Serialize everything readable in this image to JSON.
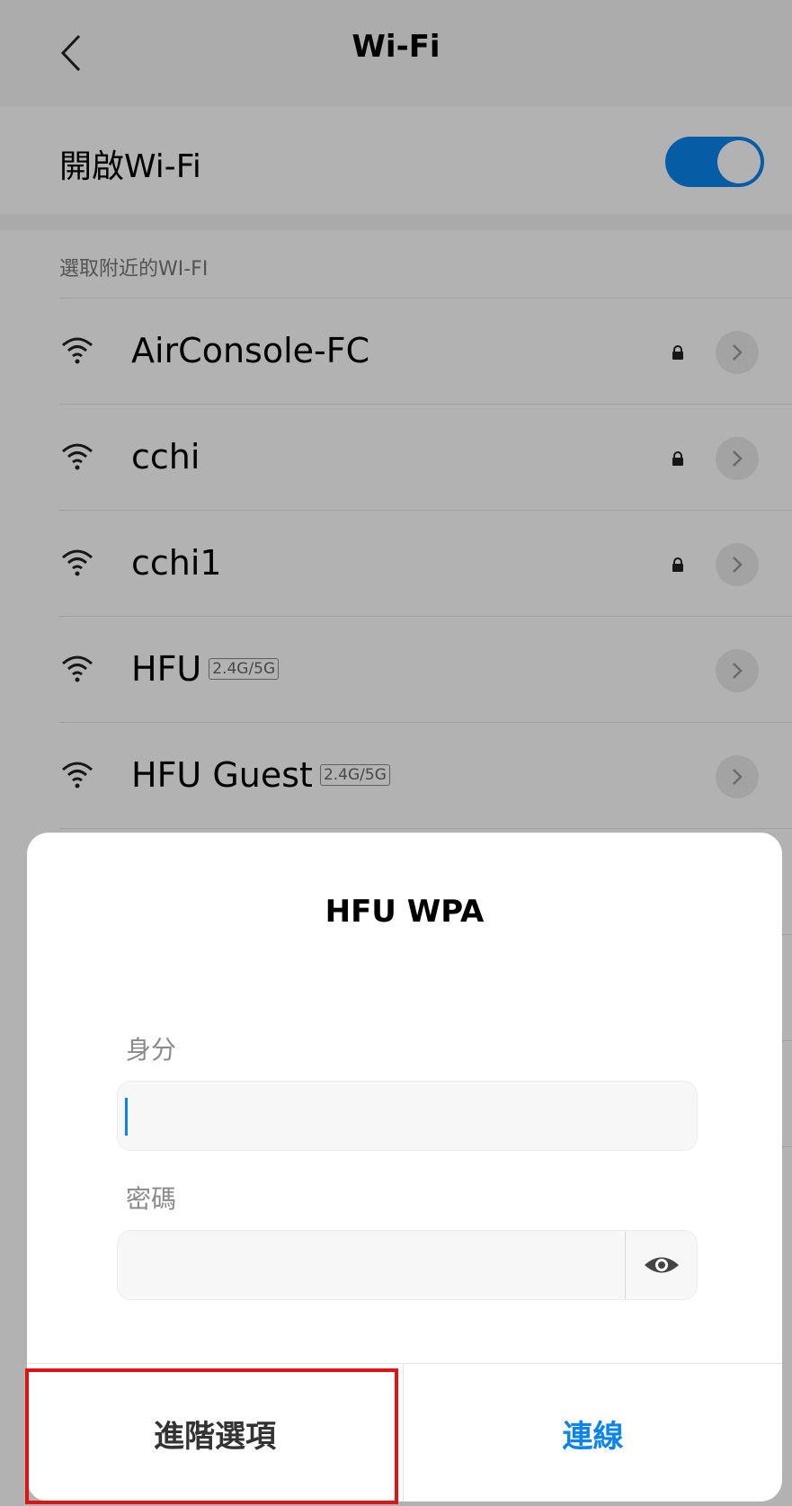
{
  "header": {
    "title": "Wi-Fi"
  },
  "wifi_toggle": {
    "label": "開啟Wi-Fi",
    "state": "on"
  },
  "networks": {
    "section_label": "選取附近的WI-FI",
    "items": [
      {
        "name": "AirConsole-FC",
        "band": "",
        "locked": true
      },
      {
        "name": "cchi",
        "band": "",
        "locked": true
      },
      {
        "name": "cchi1",
        "band": "",
        "locked": true
      },
      {
        "name": "HFU",
        "band": "2.4G/5G",
        "locked": false
      },
      {
        "name": "HFU Guest",
        "band": "2.4G/5G",
        "locked": false
      }
    ]
  },
  "dialog": {
    "title": "HFU WPA",
    "identity_label": "身分",
    "identity_value": "",
    "password_label": "密碼",
    "password_value": "",
    "advanced_label": "進階選項",
    "connect_label": "連線"
  },
  "colors": {
    "accent": "#0b84ee",
    "highlight": "#e01212"
  }
}
